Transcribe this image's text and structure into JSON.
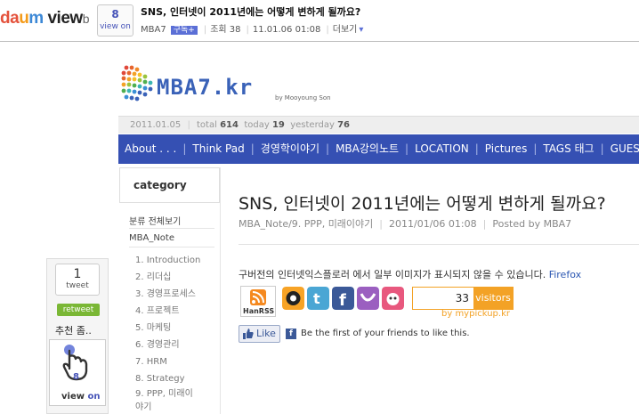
{
  "topbar": {
    "logo": {
      "part1": "da",
      "part2": "u",
      "part3": "m",
      "view": "view",
      "tail": "b"
    },
    "view_count": "8",
    "view_on_label": "view on",
    "article_title": "SNS, 인터넷이 2011년에는 어떻게 변하게 될까요?",
    "meta": {
      "blog": "MBA7",
      "subscribe": "구독+",
      "views": "조회 38",
      "datetime": "11.01.06 01:08",
      "more": "더보기"
    }
  },
  "site": {
    "logo_text": "MBA7.kr",
    "byline": "by Mooyoung Son",
    "stats": {
      "date": "2011.01.05",
      "total_label": "total",
      "total": "614",
      "today_label": "today",
      "today": "19",
      "yesterday_label": "yesterday",
      "yesterday": "76"
    },
    "nav": [
      {
        "label": "About . . ."
      },
      {
        "label": "Think Pad"
      },
      {
        "label": "경영학이야기"
      },
      {
        "label": "MBA강의노트"
      },
      {
        "label": "LOCATION"
      },
      {
        "label": "Pictures"
      },
      {
        "label": "TAGS 태그"
      },
      {
        "label": "GUEST"
      }
    ]
  },
  "sidebar": {
    "heading": "category",
    "all": "분류 전체보기",
    "main": "MBA_Note",
    "items": [
      {
        "label": "1. Introduction"
      },
      {
        "label": "2. 리더십"
      },
      {
        "label": "3. 경영프로세스"
      },
      {
        "label": "4. 프로젝트"
      },
      {
        "label": "5. 마케팅"
      },
      {
        "label": "6. 경영관리"
      },
      {
        "label": "7. HRM"
      },
      {
        "label": "8. Strategy"
      },
      {
        "label": "9. PPP, 미래이"
      },
      {
        "label": "야기"
      }
    ]
  },
  "tweet": {
    "count": "1",
    "count_label": "tweet",
    "retweet": "retweet",
    "recommend": "추천 좀..",
    "view_count": "8",
    "view_label1": "view",
    "view_label2": "on"
  },
  "post": {
    "title": "SNS, 인터넷이 2011년에는 어떻게 변하게 될까요?",
    "category": "MBA_Note/9. PPP, 미래이야기",
    "datetime": "2011/01/06 01:08",
    "author": "Posted by MBA7",
    "notice": "구버전의 인터넷익스플로러 에서 일부 이미지가 표시되지 않을 수 있습니다.",
    "notice_link": "Firefox",
    "hanrss": "HanRSS",
    "visitors": "33",
    "visitors_label": "visitors",
    "visitors_by": "by mypickup.kr",
    "like_label": "Like",
    "like_text": "Be the first of your friends to like this."
  },
  "colors": {
    "nav": "#3550b3",
    "accent": "#4653b8",
    "orange": "#f3a226",
    "facebook": "#3b5998"
  }
}
